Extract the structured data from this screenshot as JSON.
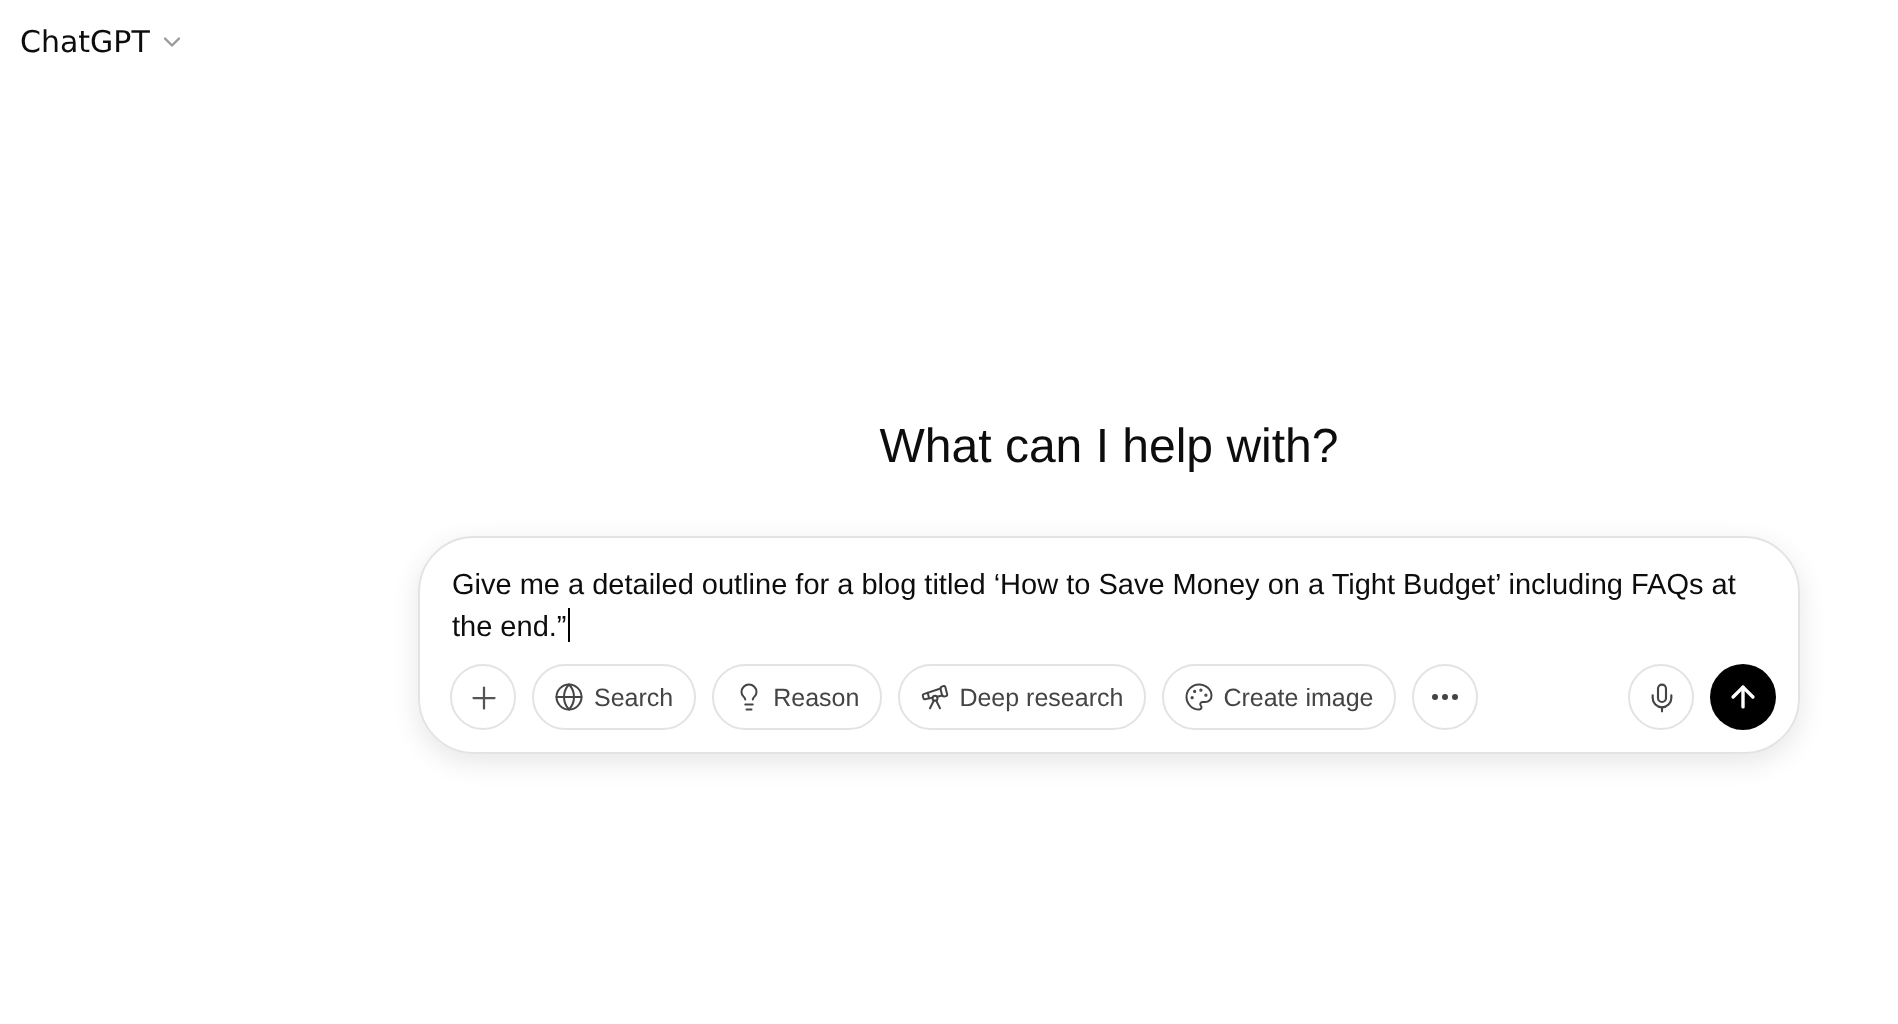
{
  "header": {
    "model": "ChatGPT"
  },
  "heading": "What can I help with?",
  "composer": {
    "value": "Give me a detailed outline for a blog titled ‘How to Save Money on a Tight Budget’ including FAQs at the end.”",
    "tools": [
      {
        "kind": "search",
        "label": "Search"
      },
      {
        "kind": "reason",
        "label": "Reason"
      },
      {
        "kind": "research",
        "label": "Deep research"
      },
      {
        "kind": "image",
        "label": "Create image"
      }
    ]
  }
}
